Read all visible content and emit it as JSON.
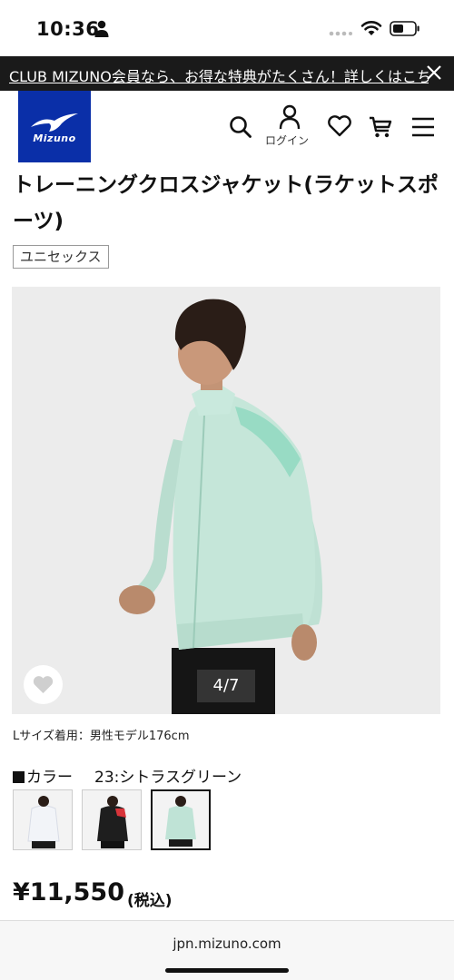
{
  "status_bar": {
    "time": "10:36"
  },
  "announcement": {
    "text": "CLUB MIZUNO会員なら、お得な特典がたくさん！詳しくはこちら"
  },
  "header": {
    "logo_text": "Mizuno",
    "login_label": "ログイン",
    "icons": [
      "search-icon",
      "account-icon",
      "heart-icon",
      "cart-icon",
      "menu-icon"
    ]
  },
  "product": {
    "title": "トレーニングクロスジャケット(ラケットスポーツ)",
    "tag": "ユニセックス",
    "image_counter": "4/7",
    "model_note": "Lサイズ着用：男性モデル176cm",
    "color_label": "カラー",
    "color_name": "23:シトラスグリーン",
    "swatches": [
      {
        "name": "white",
        "body": "#f2f4f8",
        "accent": "#d8dce6"
      },
      {
        "name": "black",
        "body": "#1e1e1e",
        "accent": "#d8343a"
      },
      {
        "name": "green",
        "body": "#bfe3d6",
        "accent": "#9fd7c6"
      }
    ],
    "price": "¥11,550",
    "price_tax": "(税込)"
  },
  "browser": {
    "url": "jpn.mizuno.com"
  },
  "colors": {
    "brand_blue": "#0a2fa8",
    "jacket_green": "#c5e6d9"
  }
}
